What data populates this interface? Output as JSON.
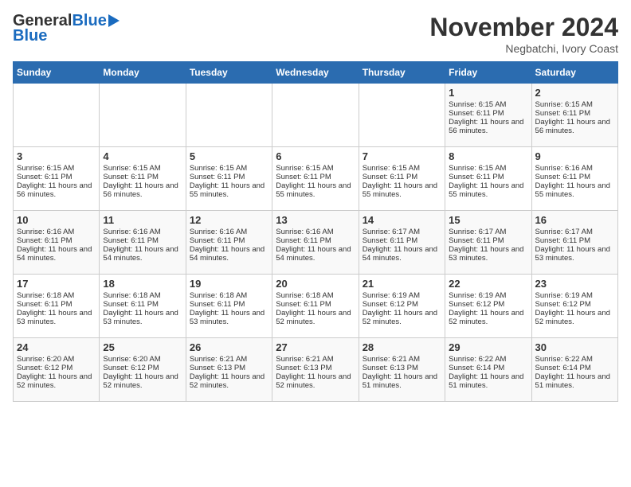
{
  "header": {
    "logo_general": "General",
    "logo_blue": "Blue",
    "month_title": "November 2024",
    "location": "Negbatchi, Ivory Coast"
  },
  "weekdays": [
    "Sunday",
    "Monday",
    "Tuesday",
    "Wednesday",
    "Thursday",
    "Friday",
    "Saturday"
  ],
  "weeks": [
    [
      {
        "day": "",
        "sunrise": "",
        "sunset": "",
        "daylight": ""
      },
      {
        "day": "",
        "sunrise": "",
        "sunset": "",
        "daylight": ""
      },
      {
        "day": "",
        "sunrise": "",
        "sunset": "",
        "daylight": ""
      },
      {
        "day": "",
        "sunrise": "",
        "sunset": "",
        "daylight": ""
      },
      {
        "day": "",
        "sunrise": "",
        "sunset": "",
        "daylight": ""
      },
      {
        "day": "1",
        "sunrise": "Sunrise: 6:15 AM",
        "sunset": "Sunset: 6:11 PM",
        "daylight": "Daylight: 11 hours and 56 minutes."
      },
      {
        "day": "2",
        "sunrise": "Sunrise: 6:15 AM",
        "sunset": "Sunset: 6:11 PM",
        "daylight": "Daylight: 11 hours and 56 minutes."
      }
    ],
    [
      {
        "day": "3",
        "sunrise": "Sunrise: 6:15 AM",
        "sunset": "Sunset: 6:11 PM",
        "daylight": "Daylight: 11 hours and 56 minutes."
      },
      {
        "day": "4",
        "sunrise": "Sunrise: 6:15 AM",
        "sunset": "Sunset: 6:11 PM",
        "daylight": "Daylight: 11 hours and 56 minutes."
      },
      {
        "day": "5",
        "sunrise": "Sunrise: 6:15 AM",
        "sunset": "Sunset: 6:11 PM",
        "daylight": "Daylight: 11 hours and 55 minutes."
      },
      {
        "day": "6",
        "sunrise": "Sunrise: 6:15 AM",
        "sunset": "Sunset: 6:11 PM",
        "daylight": "Daylight: 11 hours and 55 minutes."
      },
      {
        "day": "7",
        "sunrise": "Sunrise: 6:15 AM",
        "sunset": "Sunset: 6:11 PM",
        "daylight": "Daylight: 11 hours and 55 minutes."
      },
      {
        "day": "8",
        "sunrise": "Sunrise: 6:15 AM",
        "sunset": "Sunset: 6:11 PM",
        "daylight": "Daylight: 11 hours and 55 minutes."
      },
      {
        "day": "9",
        "sunrise": "Sunrise: 6:16 AM",
        "sunset": "Sunset: 6:11 PM",
        "daylight": "Daylight: 11 hours and 55 minutes."
      }
    ],
    [
      {
        "day": "10",
        "sunrise": "Sunrise: 6:16 AM",
        "sunset": "Sunset: 6:11 PM",
        "daylight": "Daylight: 11 hours and 54 minutes."
      },
      {
        "day": "11",
        "sunrise": "Sunrise: 6:16 AM",
        "sunset": "Sunset: 6:11 PM",
        "daylight": "Daylight: 11 hours and 54 minutes."
      },
      {
        "day": "12",
        "sunrise": "Sunrise: 6:16 AM",
        "sunset": "Sunset: 6:11 PM",
        "daylight": "Daylight: 11 hours and 54 minutes."
      },
      {
        "day": "13",
        "sunrise": "Sunrise: 6:16 AM",
        "sunset": "Sunset: 6:11 PM",
        "daylight": "Daylight: 11 hours and 54 minutes."
      },
      {
        "day": "14",
        "sunrise": "Sunrise: 6:17 AM",
        "sunset": "Sunset: 6:11 PM",
        "daylight": "Daylight: 11 hours and 54 minutes."
      },
      {
        "day": "15",
        "sunrise": "Sunrise: 6:17 AM",
        "sunset": "Sunset: 6:11 PM",
        "daylight": "Daylight: 11 hours and 53 minutes."
      },
      {
        "day": "16",
        "sunrise": "Sunrise: 6:17 AM",
        "sunset": "Sunset: 6:11 PM",
        "daylight": "Daylight: 11 hours and 53 minutes."
      }
    ],
    [
      {
        "day": "17",
        "sunrise": "Sunrise: 6:18 AM",
        "sunset": "Sunset: 6:11 PM",
        "daylight": "Daylight: 11 hours and 53 minutes."
      },
      {
        "day": "18",
        "sunrise": "Sunrise: 6:18 AM",
        "sunset": "Sunset: 6:11 PM",
        "daylight": "Daylight: 11 hours and 53 minutes."
      },
      {
        "day": "19",
        "sunrise": "Sunrise: 6:18 AM",
        "sunset": "Sunset: 6:11 PM",
        "daylight": "Daylight: 11 hours and 53 minutes."
      },
      {
        "day": "20",
        "sunrise": "Sunrise: 6:18 AM",
        "sunset": "Sunset: 6:11 PM",
        "daylight": "Daylight: 11 hours and 52 minutes."
      },
      {
        "day": "21",
        "sunrise": "Sunrise: 6:19 AM",
        "sunset": "Sunset: 6:12 PM",
        "daylight": "Daylight: 11 hours and 52 minutes."
      },
      {
        "day": "22",
        "sunrise": "Sunrise: 6:19 AM",
        "sunset": "Sunset: 6:12 PM",
        "daylight": "Daylight: 11 hours and 52 minutes."
      },
      {
        "day": "23",
        "sunrise": "Sunrise: 6:19 AM",
        "sunset": "Sunset: 6:12 PM",
        "daylight": "Daylight: 11 hours and 52 minutes."
      }
    ],
    [
      {
        "day": "24",
        "sunrise": "Sunrise: 6:20 AM",
        "sunset": "Sunset: 6:12 PM",
        "daylight": "Daylight: 11 hours and 52 minutes."
      },
      {
        "day": "25",
        "sunrise": "Sunrise: 6:20 AM",
        "sunset": "Sunset: 6:12 PM",
        "daylight": "Daylight: 11 hours and 52 minutes."
      },
      {
        "day": "26",
        "sunrise": "Sunrise: 6:21 AM",
        "sunset": "Sunset: 6:13 PM",
        "daylight": "Daylight: 11 hours and 52 minutes."
      },
      {
        "day": "27",
        "sunrise": "Sunrise: 6:21 AM",
        "sunset": "Sunset: 6:13 PM",
        "daylight": "Daylight: 11 hours and 52 minutes."
      },
      {
        "day": "28",
        "sunrise": "Sunrise: 6:21 AM",
        "sunset": "Sunset: 6:13 PM",
        "daylight": "Daylight: 11 hours and 51 minutes."
      },
      {
        "day": "29",
        "sunrise": "Sunrise: 6:22 AM",
        "sunset": "Sunset: 6:14 PM",
        "daylight": "Daylight: 11 hours and 51 minutes."
      },
      {
        "day": "30",
        "sunrise": "Sunrise: 6:22 AM",
        "sunset": "Sunset: 6:14 PM",
        "daylight": "Daylight: 11 hours and 51 minutes."
      }
    ]
  ]
}
